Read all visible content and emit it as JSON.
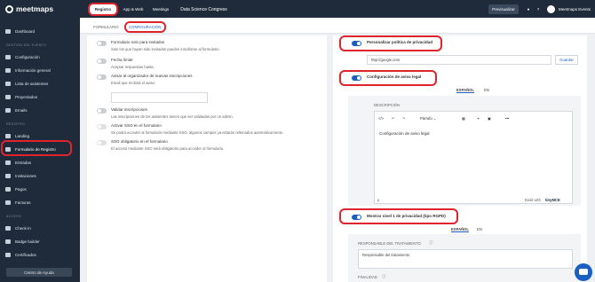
{
  "sidebar": {
    "logo": "meetmaps",
    "items": [
      {
        "label": "Dashboard",
        "icon": "dashboard-icon"
      },
      {
        "section": "GESTIÓN DEL EVENTO"
      },
      {
        "label": "Configuración",
        "icon": "gear-icon"
      },
      {
        "label": "Información general",
        "icon": "info-icon"
      },
      {
        "label": "Lista de asistentes",
        "icon": "users-icon"
      },
      {
        "label": "Proyectados",
        "icon": "projector-icon"
      },
      {
        "label": "Emails",
        "icon": "mail-icon"
      },
      {
        "section": "REGISTRO"
      },
      {
        "label": "Landing",
        "icon": "globe-icon"
      },
      {
        "label": "Formulario de Registro",
        "icon": "form-icon"
      },
      {
        "label": "Entradas",
        "icon": "ticket-icon"
      },
      {
        "label": "Invitaciones",
        "icon": "envelope-icon"
      },
      {
        "label": "Pagos",
        "icon": "payment-icon"
      },
      {
        "label": "Facturas",
        "icon": "invoice-icon"
      },
      {
        "section": "ACCESO"
      },
      {
        "label": "Check-in",
        "icon": "checkin-icon"
      },
      {
        "label": "Badge builder",
        "icon": "badge-icon"
      },
      {
        "label": "Certificados",
        "icon": "certificate-icon"
      }
    ],
    "help": "Centro de Ayuda"
  },
  "topbar": {
    "tabs": [
      "Registro",
      "App & Web",
      "Meetings"
    ],
    "event_name": "Data Science Congress",
    "preview": "Previsualizar",
    "user": "Meetmaps Events"
  },
  "subtabs": [
    "FORMULARIO",
    "CONFIGURACIÓN"
  ],
  "left": [
    {
      "title": "Formulario solo para invitados",
      "desc": "Solo los que hayan sido invitados pueden inscribirse al formulario."
    },
    {
      "title": "Fecha límite",
      "desc": "Aceptar respuestas hasta:"
    },
    {
      "title": "Avisar al organizador de nuevas inscripciones",
      "desc": "Email que recibirá el aviso:"
    },
    {
      "title": "Validar inscripciones",
      "desc": "Las inscripciones de los asistentes tienen que ser validadas por un admin."
    },
    {
      "title": "Activar SSO en el formulario",
      "desc": "Se podrá acceder al formulario mediante SSO, algunos campos ya estarán rellenados automáticamente."
    },
    {
      "title": "SSO obligatorio en el formulario",
      "desc": "El acceso mediante SSO será obligatorio para acceder al formulario."
    }
  ],
  "right": {
    "privacy_label": "Personalizar política de privacidad",
    "url_value": "http://google.com",
    "save": "Guardar",
    "legal_label": "Configuración de aviso legal",
    "langs": [
      "ESPAÑOL",
      "EN"
    ],
    "desc_label": "DESCRIPCIÓN",
    "paragraph": "Párrafo",
    "editor_text": "Configuración de aviso legal",
    "footer_p": "p",
    "built": "Build with",
    "tiny": "tinyMCE",
    "privacy1_label": "Mostrar nivel 1 de privacidad (tipo RGPD)",
    "responsable_label": "RESPONSABLE DEL TRATAMIENTO",
    "responsable_value": "Responsable del tratamiento",
    "finalidad_label": "FINALIDAD"
  },
  "colors": {
    "sidebar": "#1f2b3a",
    "accent": "#1b5fc1",
    "highlight": "#e0242c"
  }
}
